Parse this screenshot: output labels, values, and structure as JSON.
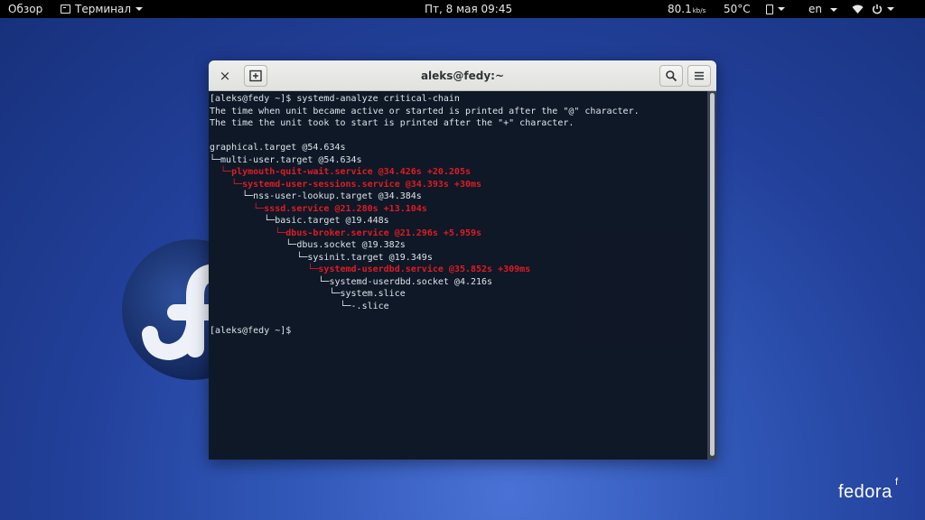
{
  "topbar": {
    "overview": "Обзор",
    "app_name": "Терминал",
    "clock": "Пт, 8 мая  09:45",
    "net_speed": "80.1",
    "net_unit": "kb/s",
    "temperature": "50°C",
    "language": "en"
  },
  "window": {
    "title": "aleks@fedy:~",
    "close_glyph": "×"
  },
  "terminal": {
    "lines": [
      {
        "text": "[aleks@fedy ~]$ systemd-analyze critical-chain",
        "red": false
      },
      {
        "text": "The time when unit became active or started is printed after the \"@\" character.",
        "red": false
      },
      {
        "text": "The time the unit took to start is printed after the \"+\" character.",
        "red": false
      },
      {
        "text": "",
        "red": false
      },
      {
        "text": "graphical.target @54.634s",
        "red": false
      },
      {
        "text": "└─multi-user.target @54.634s",
        "red": false
      },
      {
        "text": "  └─plymouth-quit-wait.service @34.426s +20.205s",
        "red": true
      },
      {
        "text": "    └─systemd-user-sessions.service @34.393s +30ms",
        "red": true
      },
      {
        "text": "      └─nss-user-lookup.target @34.384s",
        "red": false
      },
      {
        "text": "        └─sssd.service @21.280s +13.104s",
        "red": true
      },
      {
        "text": "          └─basic.target @19.448s",
        "red": false
      },
      {
        "text": "            └─dbus-broker.service @21.296s +5.959s",
        "red": true
      },
      {
        "text": "              └─dbus.socket @19.382s",
        "red": false
      },
      {
        "text": "                └─sysinit.target @19.349s",
        "red": false
      },
      {
        "text": "                  └─systemd-userdbd.service @35.852s +309ms",
        "red": true
      },
      {
        "text": "                    └─systemd-userdbd.socket @4.216s",
        "red": false
      },
      {
        "text": "                      └─system.slice",
        "red": false
      },
      {
        "text": "                        └─-.slice",
        "red": false
      },
      {
        "text": "",
        "red": false
      },
      {
        "text": "[aleks@fedy ~]$",
        "red": false
      }
    ]
  },
  "desktop": {
    "brand_word": "fedora",
    "brand_mark": "f"
  },
  "colors": {
    "terminal_red": "#e01b24",
    "terminal_text": "#dde3ea",
    "panel": "#000000"
  },
  "icons": [
    "terminal-icon",
    "clipboard-icon",
    "wifi-icon",
    "power-icon",
    "new-tab-icon",
    "search-icon",
    "hamburger-menu-icon",
    "fedora-logo"
  ]
}
